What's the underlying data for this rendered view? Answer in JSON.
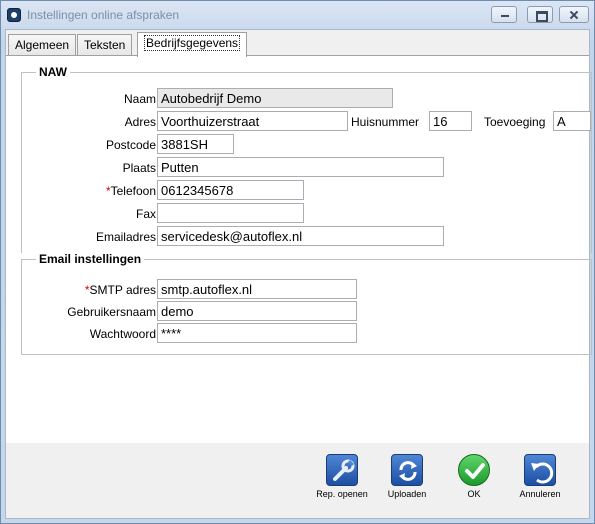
{
  "window": {
    "title": "Instellingen online afspraken"
  },
  "tabs": [
    {
      "label": "Algemeen"
    },
    {
      "label": "Teksten"
    },
    {
      "label": "Bedrijfsgegevens"
    }
  ],
  "naw": {
    "legend": "NAW",
    "naam_label": "Naam",
    "naam": "Autobedrijf Demo",
    "adres_label": "Adres",
    "adres": "Voorthuizerstraat",
    "huisnummer_label": "Huisnummer",
    "huisnummer": "16",
    "toevoeging_label": "Toevoeging",
    "toevoeging": "A",
    "postcode_label": "Postcode",
    "postcode": "3881SH",
    "plaats_label": "Plaats",
    "plaats": "Putten",
    "telefoon_required": "*",
    "telefoon_label": "Telefoon",
    "telefoon": "0612345678",
    "fax_label": "Fax",
    "fax": "",
    "email_label": "Emailadres",
    "email": "servicedesk@autoflex.nl"
  },
  "email_settings": {
    "legend": "Email instellingen",
    "smtp_required": "*",
    "smtp_label": "SMTP adres",
    "smtp": "smtp.autoflex.nl",
    "user_label": "Gebruikersnaam",
    "user": "demo",
    "password_label": "Wachtwoord",
    "password": "****"
  },
  "actions": {
    "rep_openen": "Rep. openen",
    "uploaden": "Uploaden",
    "ok": "OK",
    "annuleren": "Annuleren"
  }
}
